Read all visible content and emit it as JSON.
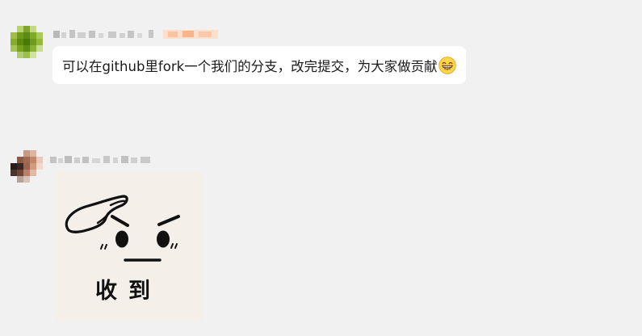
{
  "messages": [
    {
      "sender_name": "",
      "text": "可以在github里fork一个我们的分支，改完提交，为大家做贡献",
      "emoji": "grinning-face-with-smiling-eyes-icon"
    },
    {
      "sender_name": "",
      "sticker": {
        "caption": "收到",
        "icon": "salute-face-sticker"
      }
    }
  ],
  "colors": {
    "background": "#f1f1f1",
    "bubble": "#ffffff",
    "sticker_bg": "#f4efe8",
    "text": "#1a1a1a"
  }
}
